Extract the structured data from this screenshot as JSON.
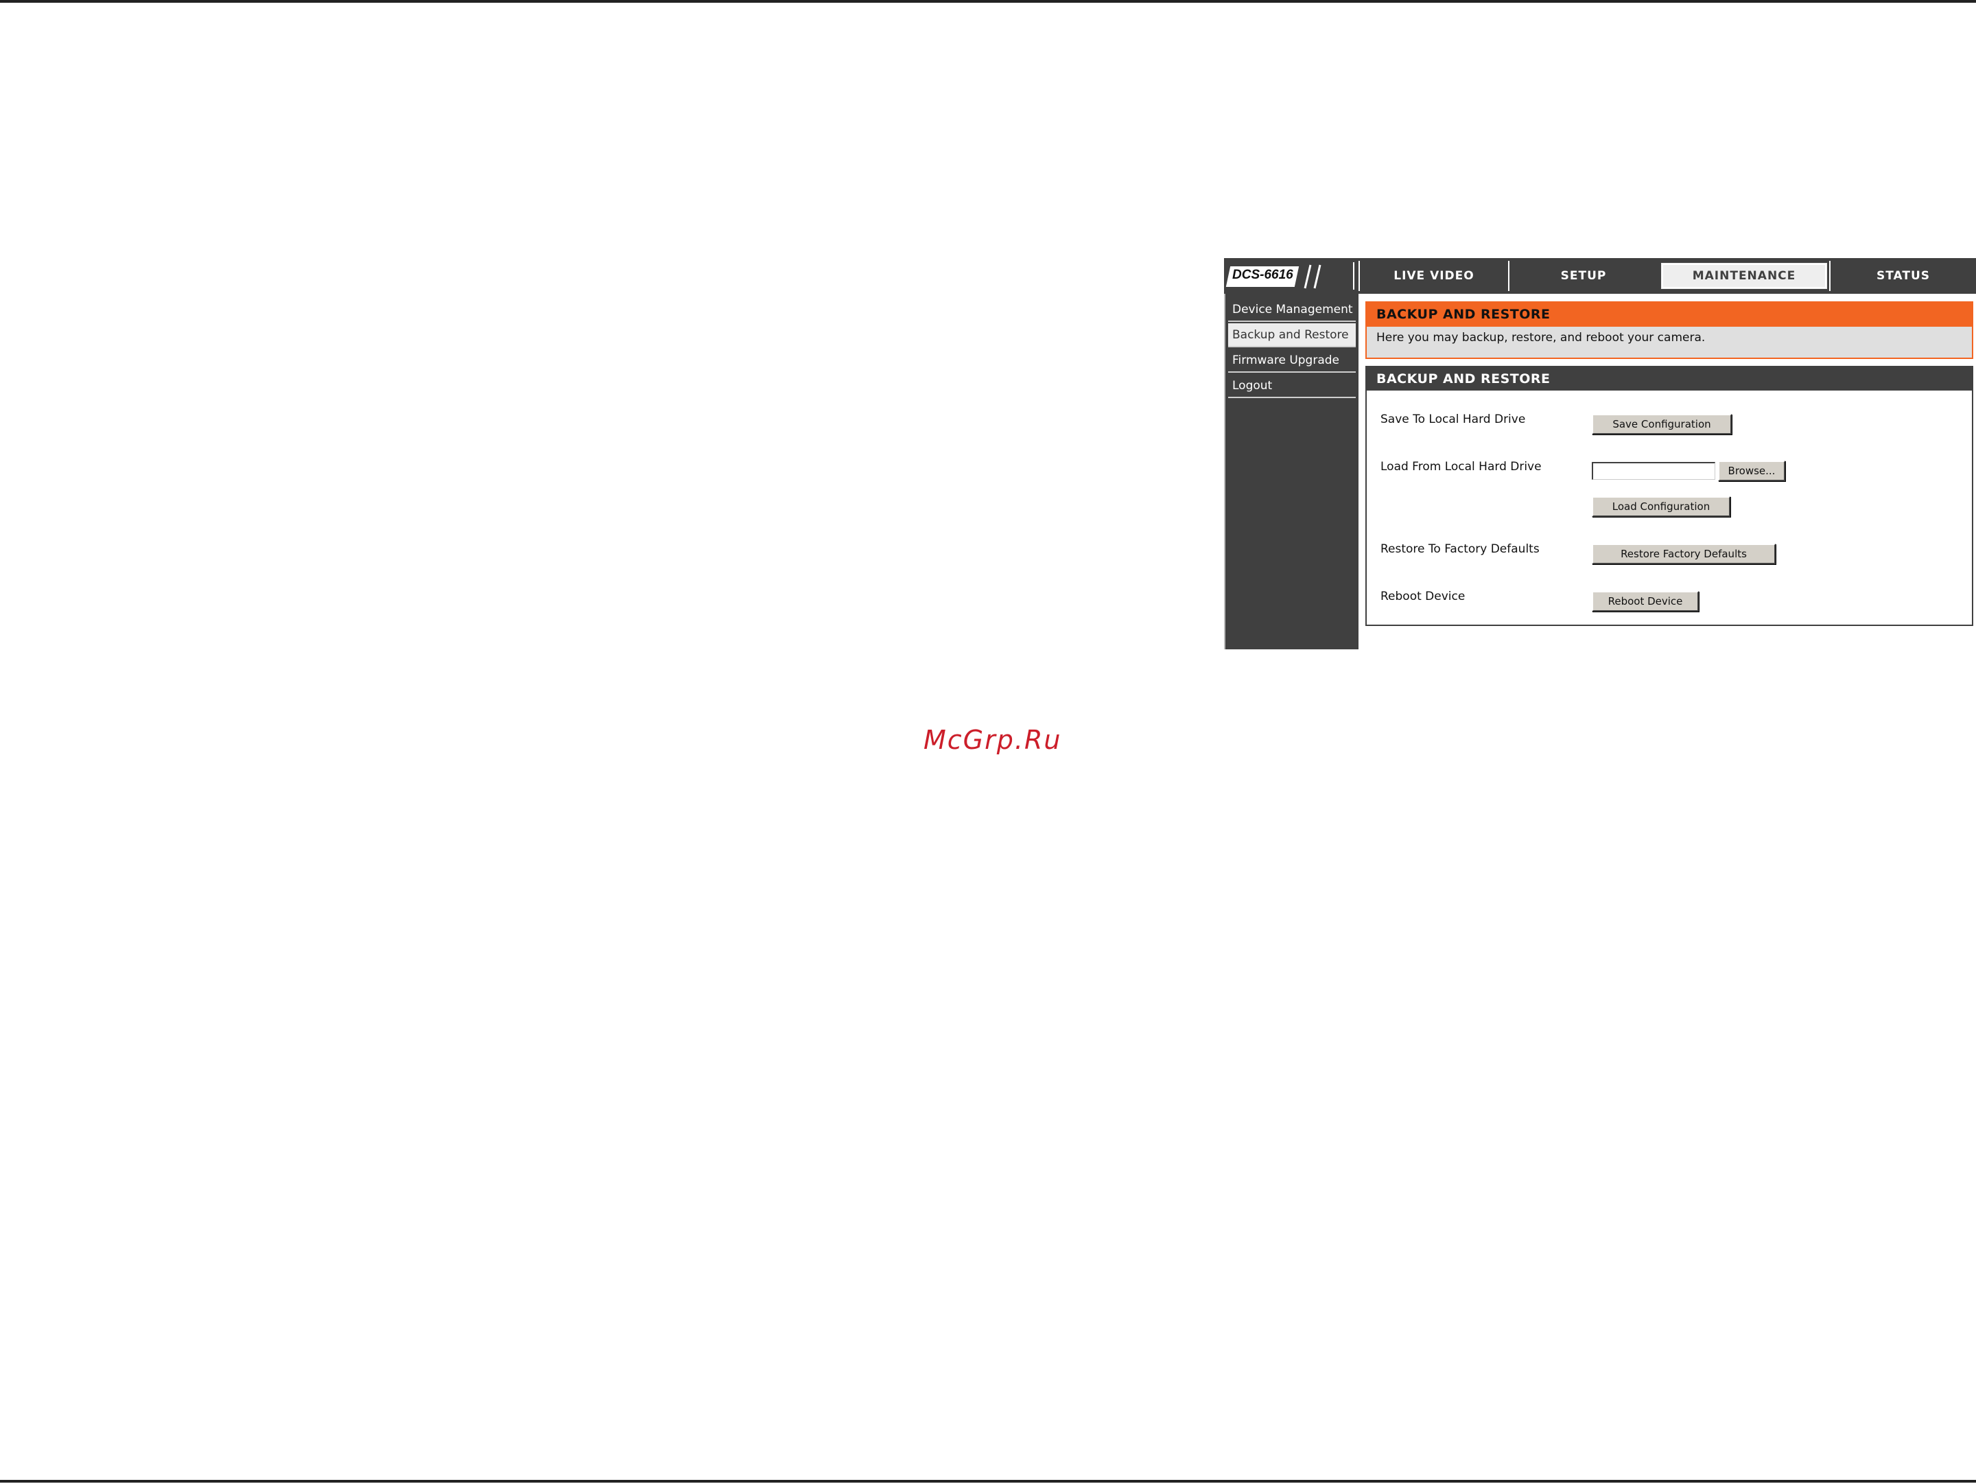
{
  "camera_ui": {
    "model": "DCS-6616",
    "nav_tabs": [
      {
        "label": "LIVE VIDEO",
        "active": false
      },
      {
        "label": "SETUP",
        "active": false
      },
      {
        "label": "MAINTENANCE",
        "active": true
      },
      {
        "label": "STATUS",
        "active": false
      }
    ],
    "sidebar": [
      {
        "label": "Device Management",
        "active": false
      },
      {
        "label": "Backup and Restore",
        "active": true
      },
      {
        "label": "Firmware Upgrade",
        "active": false
      },
      {
        "label": "Logout",
        "active": false
      }
    ],
    "intro": {
      "title": "BACKUP AND RESTORE",
      "description": "Here you may backup, restore, and reboot your camera."
    },
    "panel": {
      "title": "BACKUP AND RESTORE",
      "save_label": "Save To Local Hard Drive",
      "save_button": "Save Configuration",
      "load_label": "Load From Local Hard Drive",
      "file_value": "",
      "browse_button": "Browse...",
      "load_button": "Load Configuration",
      "restore_label": "Restore To Factory Defaults",
      "restore_button": "Restore Factory Defaults",
      "reboot_label": "Reboot Device",
      "reboot_button": "Reboot Device"
    },
    "colors": {
      "accent": "#f26522",
      "dark": "#404040",
      "intro_bg": "#dfdfdf"
    }
  },
  "watermark": "McGrp.Ru"
}
